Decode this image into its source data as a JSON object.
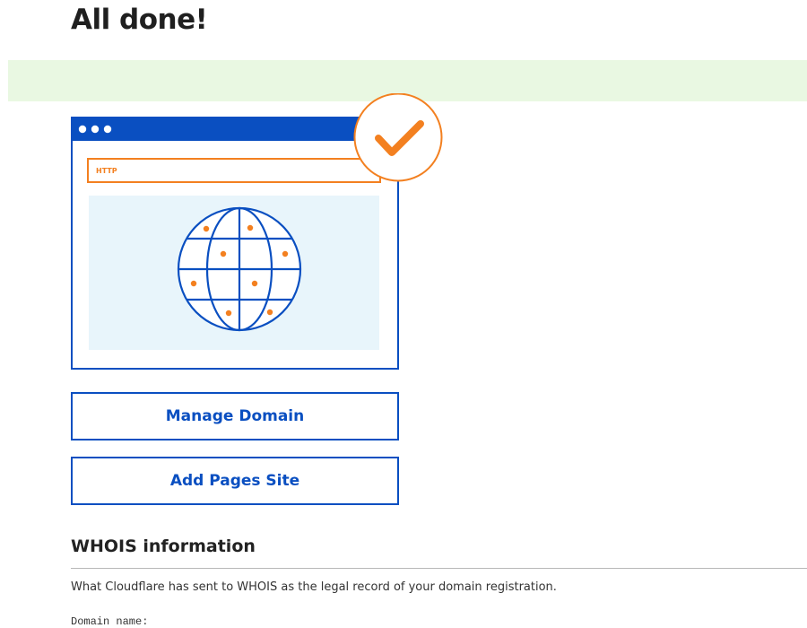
{
  "header": {
    "title": "All done!"
  },
  "illustration": {
    "url_bar_text": "HTTP",
    "colors": {
      "brand_blue": "#0a4fc1",
      "accent_orange": "#f38020",
      "globe_panel": "#e8f5fb"
    },
    "icons": [
      "window-dots-icon",
      "checkmark-icon",
      "globe-icon"
    ]
  },
  "actions": {
    "manage_domain_label": "Manage Domain",
    "add_pages_site_label": "Add Pages Site"
  },
  "whois": {
    "heading": "WHOIS information",
    "description": "What Cloudflare has sent to WHOIS as the legal record of your domain registration.",
    "domain_name_label": "Domain name:"
  },
  "colors": {
    "success_banner": "#e9f8e2",
    "link_blue": "#0a4fc1"
  }
}
